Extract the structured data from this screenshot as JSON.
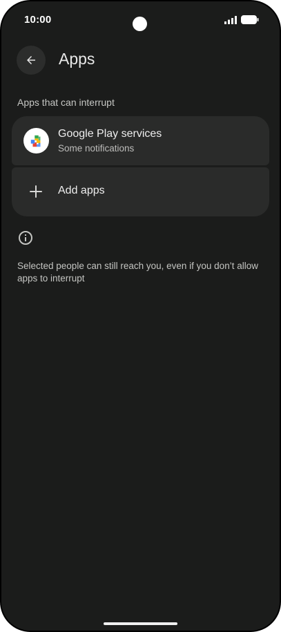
{
  "status_bar": {
    "time": "10:00",
    "icons": [
      "signal-icon",
      "battery-icon"
    ]
  },
  "header": {
    "back_icon": "arrow-back-icon",
    "title": "Apps"
  },
  "section": {
    "label": "Apps that can interrupt"
  },
  "apps": [
    {
      "name": "Google Play services",
      "subtitle": "Some notifications",
      "icon": "google-play-services-icon"
    }
  ],
  "add_apps": {
    "icon": "plus-icon",
    "label": "Add apps"
  },
  "footer": {
    "icon": "info-icon",
    "text": "Selected people can still reach you, even if you don’t allow apps to interrupt"
  },
  "colors": {
    "background": "#1b1c1b",
    "card": "#2a2b2a",
    "text_primary": "#eeeeee",
    "text_secondary": "#bdbdbb"
  }
}
